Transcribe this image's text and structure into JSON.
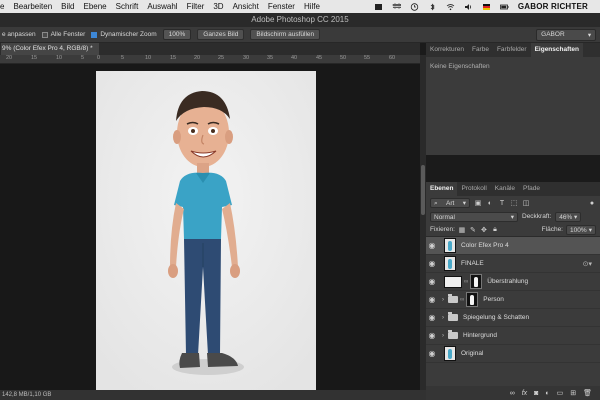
{
  "menubar": {
    "items": [
      "e",
      "Bearbeiten",
      "Bild",
      "Ebene",
      "Schrift",
      "Auswahl",
      "Filter",
      "3D",
      "Ansicht",
      "Fenster",
      "Hilfe"
    ],
    "user": "GABOR RICHTER",
    "tray_icons": [
      "app-icon",
      "dropbox-icon",
      "clock-icon",
      "bluetooth-icon",
      "wifi-icon",
      "volume-icon",
      "flag-icon",
      "battery-icon"
    ]
  },
  "app": {
    "title": "Adobe Photoshop CC 2015"
  },
  "options": {
    "fit_label": "e anpassen",
    "all_windows_label": "Alle Fenster",
    "dynamic_zoom_label": "Dynamischer Zoom",
    "zoom_value": "100%",
    "whole_image_btn": "Ganzes Bild",
    "fill_screen_btn": "Bildschirm ausfüllen",
    "workspace_value": "GABOR"
  },
  "document": {
    "tab_label": "9% (Color Efex Pro 4, RGB/8) *"
  },
  "ruler": {
    "ticks": [
      "20",
      "15",
      "10",
      "5",
      "0",
      "5",
      "10",
      "15",
      "20",
      "25",
      "30",
      "35",
      "40",
      "45",
      "50",
      "55",
      "60"
    ]
  },
  "status": {
    "text": "142,8 MB/1,10 GB"
  },
  "panel_top": {
    "tabs": [
      "Korrekturen",
      "Farbe",
      "Farbfelder",
      "Eigenschaften"
    ],
    "active_tab": "Eigenschaften",
    "empty_text": "Keine Eigenschaften"
  },
  "layers_panel": {
    "tabs": [
      "Ebenen",
      "Protokoll",
      "Kanäle",
      "Pfade"
    ],
    "kind_filter": "Art",
    "blend_mode": "Normal",
    "opacity_label": "Deckkraft:",
    "opacity_value": "46%",
    "lock_label": "Fixieren:",
    "fill_label": "Fläche:",
    "fill_value": "100%",
    "layers": [
      {
        "name": "Color Efex Pro 4"
      },
      {
        "name": "FINALE"
      },
      {
        "name": "Überstrahlung"
      },
      {
        "name": "Person"
      },
      {
        "name": "Spiegelung & Schatten"
      },
      {
        "name": "Hintergrund"
      },
      {
        "name": "Original"
      }
    ],
    "footer_icons": [
      "link-icon",
      "fx-icon",
      "mask-icon",
      "adjustment-icon",
      "group-icon",
      "new-layer-icon",
      "trash-icon"
    ]
  }
}
